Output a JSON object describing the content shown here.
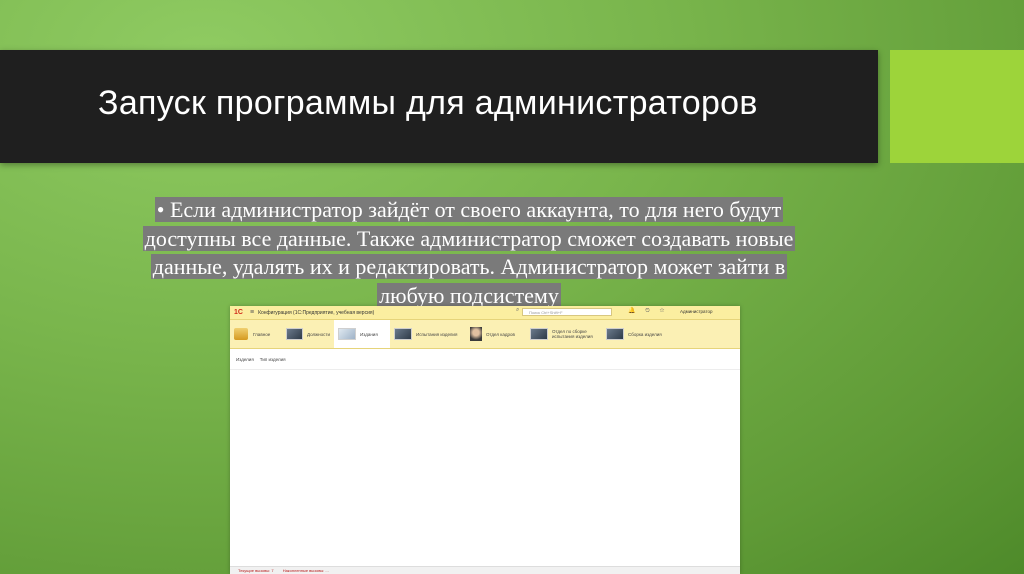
{
  "slide": {
    "title": "Запуск программы для администраторов",
    "bullet_lines": [
      "• Если администратор зайдёт от своего аккаунта, то для него будут",
      "доступны все данные. Также администратор сможет создавать новые",
      "данные, удалять их и редактировать. Администратор может зайти в",
      "любую подсистему"
    ]
  },
  "app": {
    "logo": "1С",
    "menu_icon": "≡",
    "title": "Конфигурация (1С:Предприятие, учебная версия)",
    "search_placeholder": "Поиск Ctrl+Shift+F",
    "search_icon": "⌕",
    "toolbar_icons": "🔔 ⏲ ☆",
    "user": "Администратор",
    "sections": [
      "Главное",
      "Должности",
      "Издания",
      "Испытания изделия",
      "Отдел кадров",
      "Отдел по сборке испытания изделия",
      "Сборка изделия"
    ],
    "subbar": [
      "Изделия",
      "Тип изделия"
    ],
    "status": [
      "Текущие вызовы: 7",
      "Накопленные вызовы: ..."
    ]
  },
  "colors": {
    "title_bar": "#1f1f1f",
    "accent": "#9dd43a",
    "app_header": "#fbf0b4",
    "app_title_bar": "#fbeea0"
  }
}
